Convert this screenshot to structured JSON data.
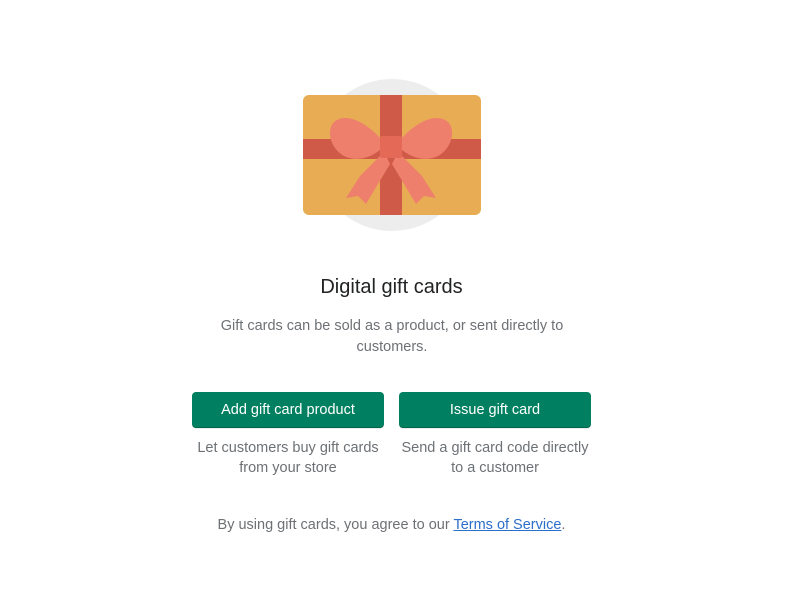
{
  "colors": {
    "primary_button": "#008060",
    "link": "#2c6ecb",
    "subdued_text": "#6d7175",
    "card_body": "#e8ad54",
    "ribbon": "#cf5a48",
    "bow": "#ef7f6d",
    "backdrop_circle": "#ededed"
  },
  "illustration": {
    "icon": "gift-card-icon"
  },
  "empty_state": {
    "title": "Digital gift cards",
    "description": "Gift cards can be sold as a product, or sent directly to customers."
  },
  "actions": {
    "add_product": {
      "label": "Add gift card product",
      "help": "Let customers buy gift cards from your store"
    },
    "issue_card": {
      "label": "Issue gift card",
      "help": "Send a gift card code directly to a customer"
    }
  },
  "footer": {
    "prefix": "By using gift cards, you agree to our ",
    "link_label": "Terms of Service",
    "suffix": "."
  }
}
